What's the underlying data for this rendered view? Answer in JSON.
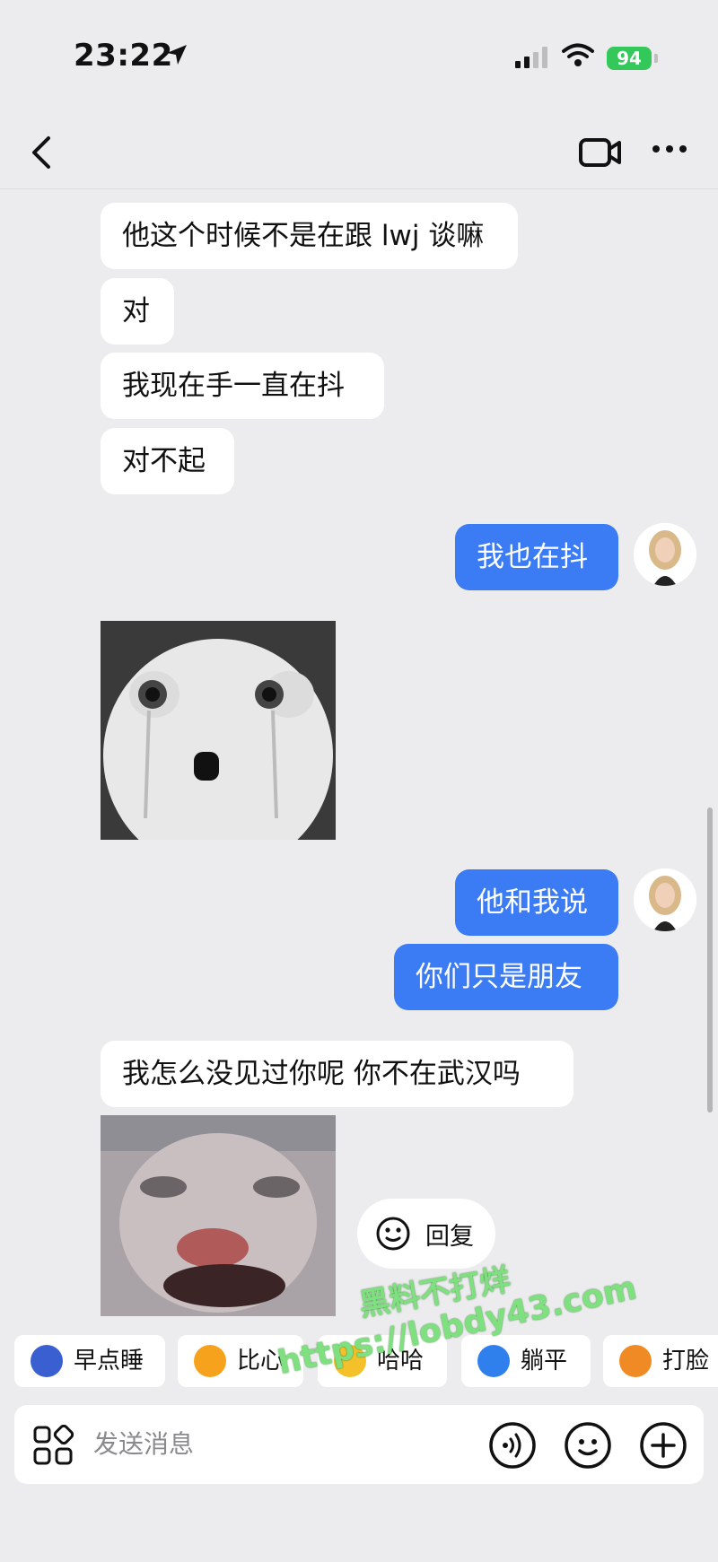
{
  "status_bar": {
    "time": "23:22",
    "battery": "94"
  },
  "nav": {
    "back": "back",
    "video": "video-call",
    "more": "more"
  },
  "messages": [
    {
      "side": "left",
      "text": "他这个时候不是在跟 lwj 谈嘛"
    },
    {
      "side": "left",
      "text": "对"
    },
    {
      "side": "left",
      "text": "我现在手一直在抖"
    },
    {
      "side": "left",
      "text": "对不起"
    },
    {
      "side": "right",
      "text": "我也在抖"
    },
    {
      "side": "left",
      "type": "sticker",
      "icon": "crying-ghost-sticker"
    },
    {
      "side": "right",
      "text": "他和我说"
    },
    {
      "side": "right",
      "text": "你们只是朋友"
    },
    {
      "side": "left",
      "text": "我怎么没见过你呢 你不在武汉吗"
    },
    {
      "side": "left",
      "type": "sticker",
      "icon": "screaming-cat-sticker"
    }
  ],
  "reply_chip": {
    "label": "回复"
  },
  "quick_replies": [
    {
      "label": "早点睡",
      "color": "#3a5fd0"
    },
    {
      "label": "比心",
      "color": "#f7a21c"
    },
    {
      "label": "哈哈",
      "color": "#f5c12a"
    },
    {
      "label": "躺平",
      "color": "#2f80ed"
    },
    {
      "label": "打脸",
      "color": "#f08a24"
    }
  ],
  "input": {
    "placeholder": "发送消息"
  },
  "watermark": {
    "line1": "黑料不打烊",
    "line2": "https://lobdy43.com"
  },
  "colors": {
    "accent": "#3b7cf5",
    "background": "#ececee"
  }
}
